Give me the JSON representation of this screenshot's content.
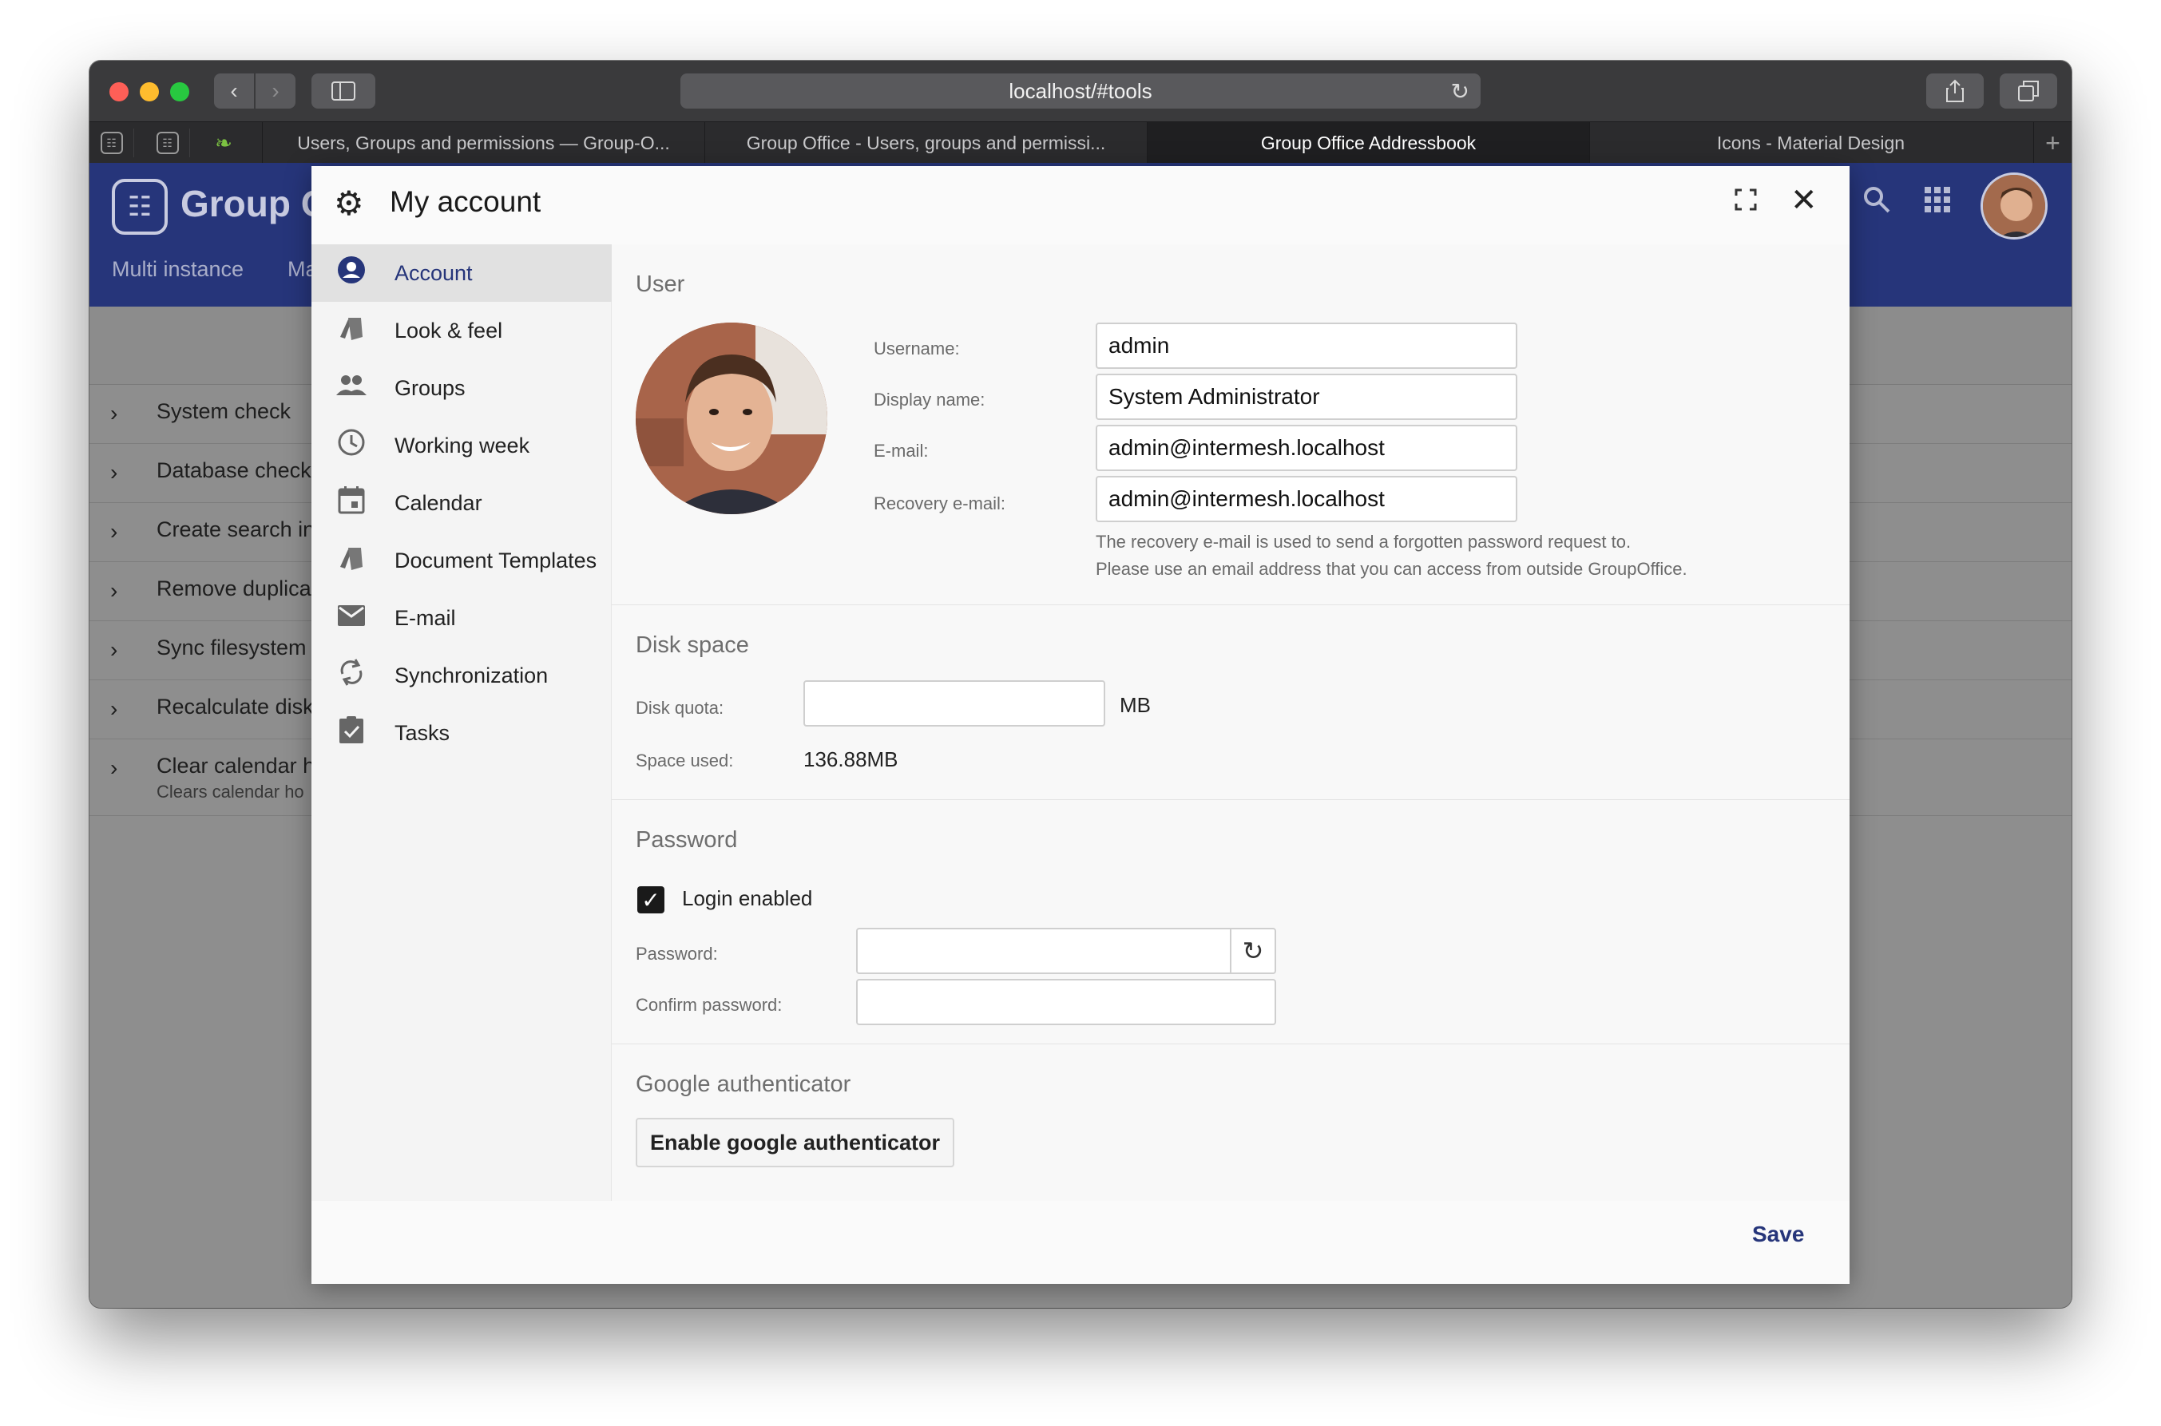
{
  "browser": {
    "url": "localhost/#tools",
    "tabs": [
      {
        "label": "Users, Groups and permissions — Group-O..."
      },
      {
        "label": "Group Office - Users, groups and permissi..."
      },
      {
        "label": "Group Office Addressbook"
      },
      {
        "label": "Icons - Material Design"
      }
    ],
    "active_tab": 2
  },
  "app": {
    "name": "Group O",
    "tabs": [
      {
        "label": "Multi instance"
      },
      {
        "label": "Ma"
      }
    ],
    "tools": [
      {
        "label": "System check"
      },
      {
        "label": "Database check"
      },
      {
        "label": "Create search in"
      },
      {
        "label": "Remove duplica"
      },
      {
        "label": "Sync filesystem"
      },
      {
        "label": "Recalculate disk"
      },
      {
        "label": "Clear calendar h",
        "sub": "Clears calendar ho"
      }
    ]
  },
  "dialog": {
    "title": "My account",
    "nav": [
      {
        "label": "Account",
        "icon": "account-circle-icon"
      },
      {
        "label": "Look & feel",
        "icon": "style-icon"
      },
      {
        "label": "Groups",
        "icon": "group-icon"
      },
      {
        "label": "Working week",
        "icon": "clock-icon"
      },
      {
        "label": "Calendar",
        "icon": "calendar-icon"
      },
      {
        "label": "Document Templates",
        "icon": "style-icon"
      },
      {
        "label": "E-mail",
        "icon": "email-icon"
      },
      {
        "label": "Synchronization",
        "icon": "sync-icon"
      },
      {
        "label": "Tasks",
        "icon": "task-icon"
      }
    ],
    "user": {
      "section_title": "User",
      "username_label": "Username:",
      "username": "admin",
      "display_name_label": "Display name:",
      "display_name": "System Administrator",
      "email_label": "E-mail:",
      "email": "admin@intermesh.localhost",
      "recovery_label": "Recovery e-mail:",
      "recovery_email": "admin@intermesh.localhost",
      "recovery_hint_1": "The recovery e-mail is used to send a forgotten password request to.",
      "recovery_hint_2": "Please use an email address that you can access from outside GroupOffice."
    },
    "disk": {
      "section_title": "Disk space",
      "quota_label": "Disk quota:",
      "quota_value": "",
      "quota_unit": "MB",
      "used_label": "Space used:",
      "used_value": "136.88MB"
    },
    "password": {
      "section_title": "Password",
      "login_enabled_label": "Login enabled",
      "login_enabled": true,
      "password_label": "Password:",
      "confirm_label": "Confirm password:"
    },
    "google": {
      "section_title": "Google authenticator",
      "enable_label": "Enable google authenticator"
    },
    "save_label": "Save"
  },
  "colors": {
    "brand": "#26357a",
    "titlebar": "#3a3a3c",
    "overlay_app": "#8e8e8e"
  }
}
